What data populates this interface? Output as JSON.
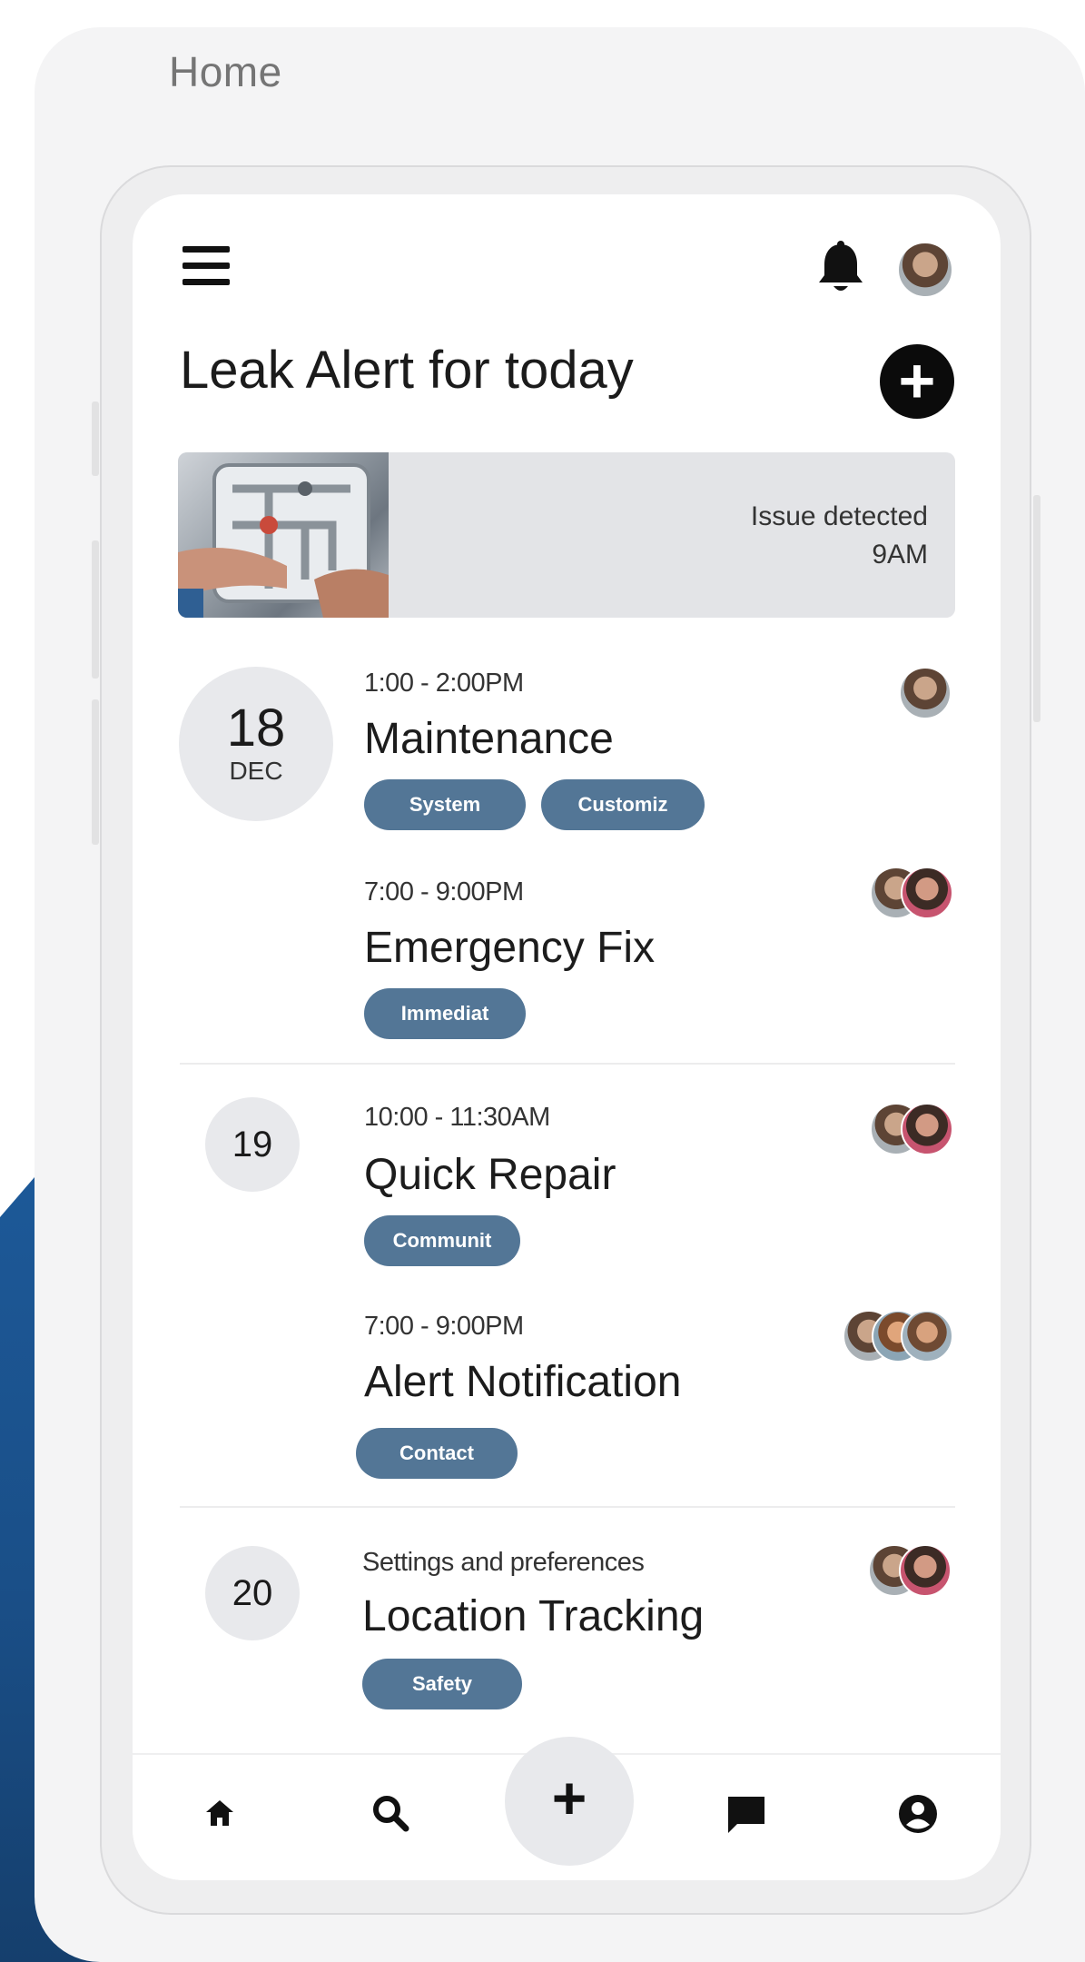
{
  "page": {
    "breadcrumb": "Home"
  },
  "header": {
    "menu_icon": "hamburger-icon",
    "notification_icon": "bell-icon",
    "profile_icon": "avatar"
  },
  "main": {
    "title": "Leak Alert for today",
    "add_icon": "plus-circle-icon",
    "alert": {
      "status_line1": "Issue detected",
      "status_line2": "9AM"
    }
  },
  "schedule": [
    {
      "day": "18",
      "month": "DEC",
      "events": [
        {
          "time": "1:00 - 2:00PM",
          "title": "Maintenance",
          "tags": [
            "System",
            "Customiz"
          ],
          "attendees": 1
        },
        {
          "time": "7:00 - 9:00PM",
          "title": "Emergency Fix",
          "tags": [
            "Immediat"
          ],
          "attendees": 2
        }
      ]
    },
    {
      "day": "19",
      "events": [
        {
          "time": "10:00 - 11:30AM",
          "title": "Quick Repair",
          "tags": [
            "Communit"
          ],
          "attendees": 2
        },
        {
          "time": "7:00 - 9:00PM",
          "title": "Alert Notification",
          "tags": [
            "Contact"
          ],
          "attendees": 3
        }
      ]
    },
    {
      "day": "20",
      "events": [
        {
          "time": "Settings and preferences",
          "title": "Location Tracking",
          "tags": [
            "Safety"
          ],
          "attendees": 2
        }
      ]
    }
  ],
  "bottom_nav": {
    "items": [
      "home-icon",
      "search-icon",
      "plus-icon",
      "chat-icon",
      "profile-icon"
    ],
    "fab_label": "+"
  },
  "colors": {
    "accent_tag": "#537696",
    "background_blue": "#1d5a9a",
    "card_bg": "#f4f4f5"
  }
}
